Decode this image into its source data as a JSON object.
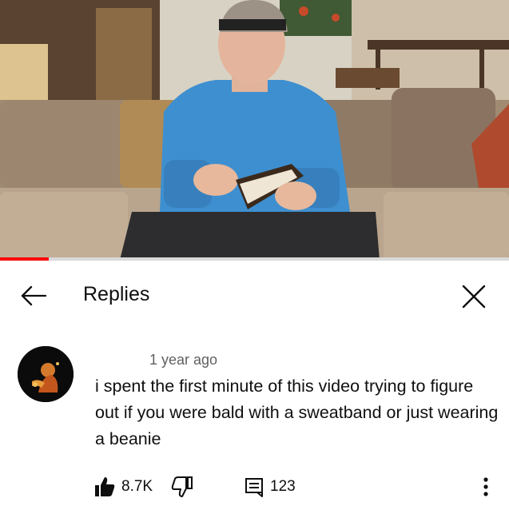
{
  "video": {
    "progress_fraction": 0.095
  },
  "header": {
    "title": "Replies",
    "back_icon": "arrow-left-icon",
    "close_icon": "close-icon"
  },
  "comment": {
    "timestamp": "1 year ago",
    "text": "i spent the first minute of this video trying to figure out if you were bald with a sweatband or just wearing a beanie",
    "like_count": "8.7K",
    "reply_count": "123",
    "icons": {
      "like": "thumbs-up-filled-icon",
      "dislike": "thumbs-down-icon",
      "replies": "comment-icon",
      "more": "more-vertical-icon"
    }
  },
  "colors": {
    "progress": "#ff0000",
    "text_primary": "#0f0f0f",
    "text_secondary": "#606060"
  }
}
